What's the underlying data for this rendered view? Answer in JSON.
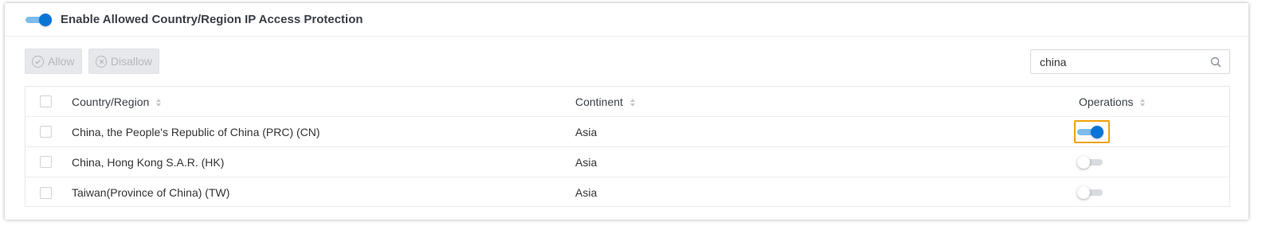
{
  "header": {
    "toggle_state": "on",
    "title": "Enable Allowed Country/Region IP Access Protection"
  },
  "toolbar": {
    "allow_label": "Allow",
    "disallow_label": "Disallow",
    "allow_icon": "check-circle-icon",
    "disallow_icon": "x-circle-icon"
  },
  "search": {
    "value": "china",
    "icon": "search-icon"
  },
  "table": {
    "columns": [
      "Country/Region",
      "Continent",
      "Operations"
    ],
    "rows": [
      {
        "country": "China, the People's Republic of China (PRC) (CN)",
        "continent": "Asia",
        "enabled": true
      },
      {
        "country": "China, Hong Kong S.A.R. (HK)",
        "continent": "Asia",
        "enabled": false
      },
      {
        "country": "Taiwan(Province of China) (TW)",
        "continent": "Asia",
        "enabled": false
      }
    ]
  },
  "colors": {
    "accent": "#0a74d6",
    "highlight": "#f2a10a"
  }
}
